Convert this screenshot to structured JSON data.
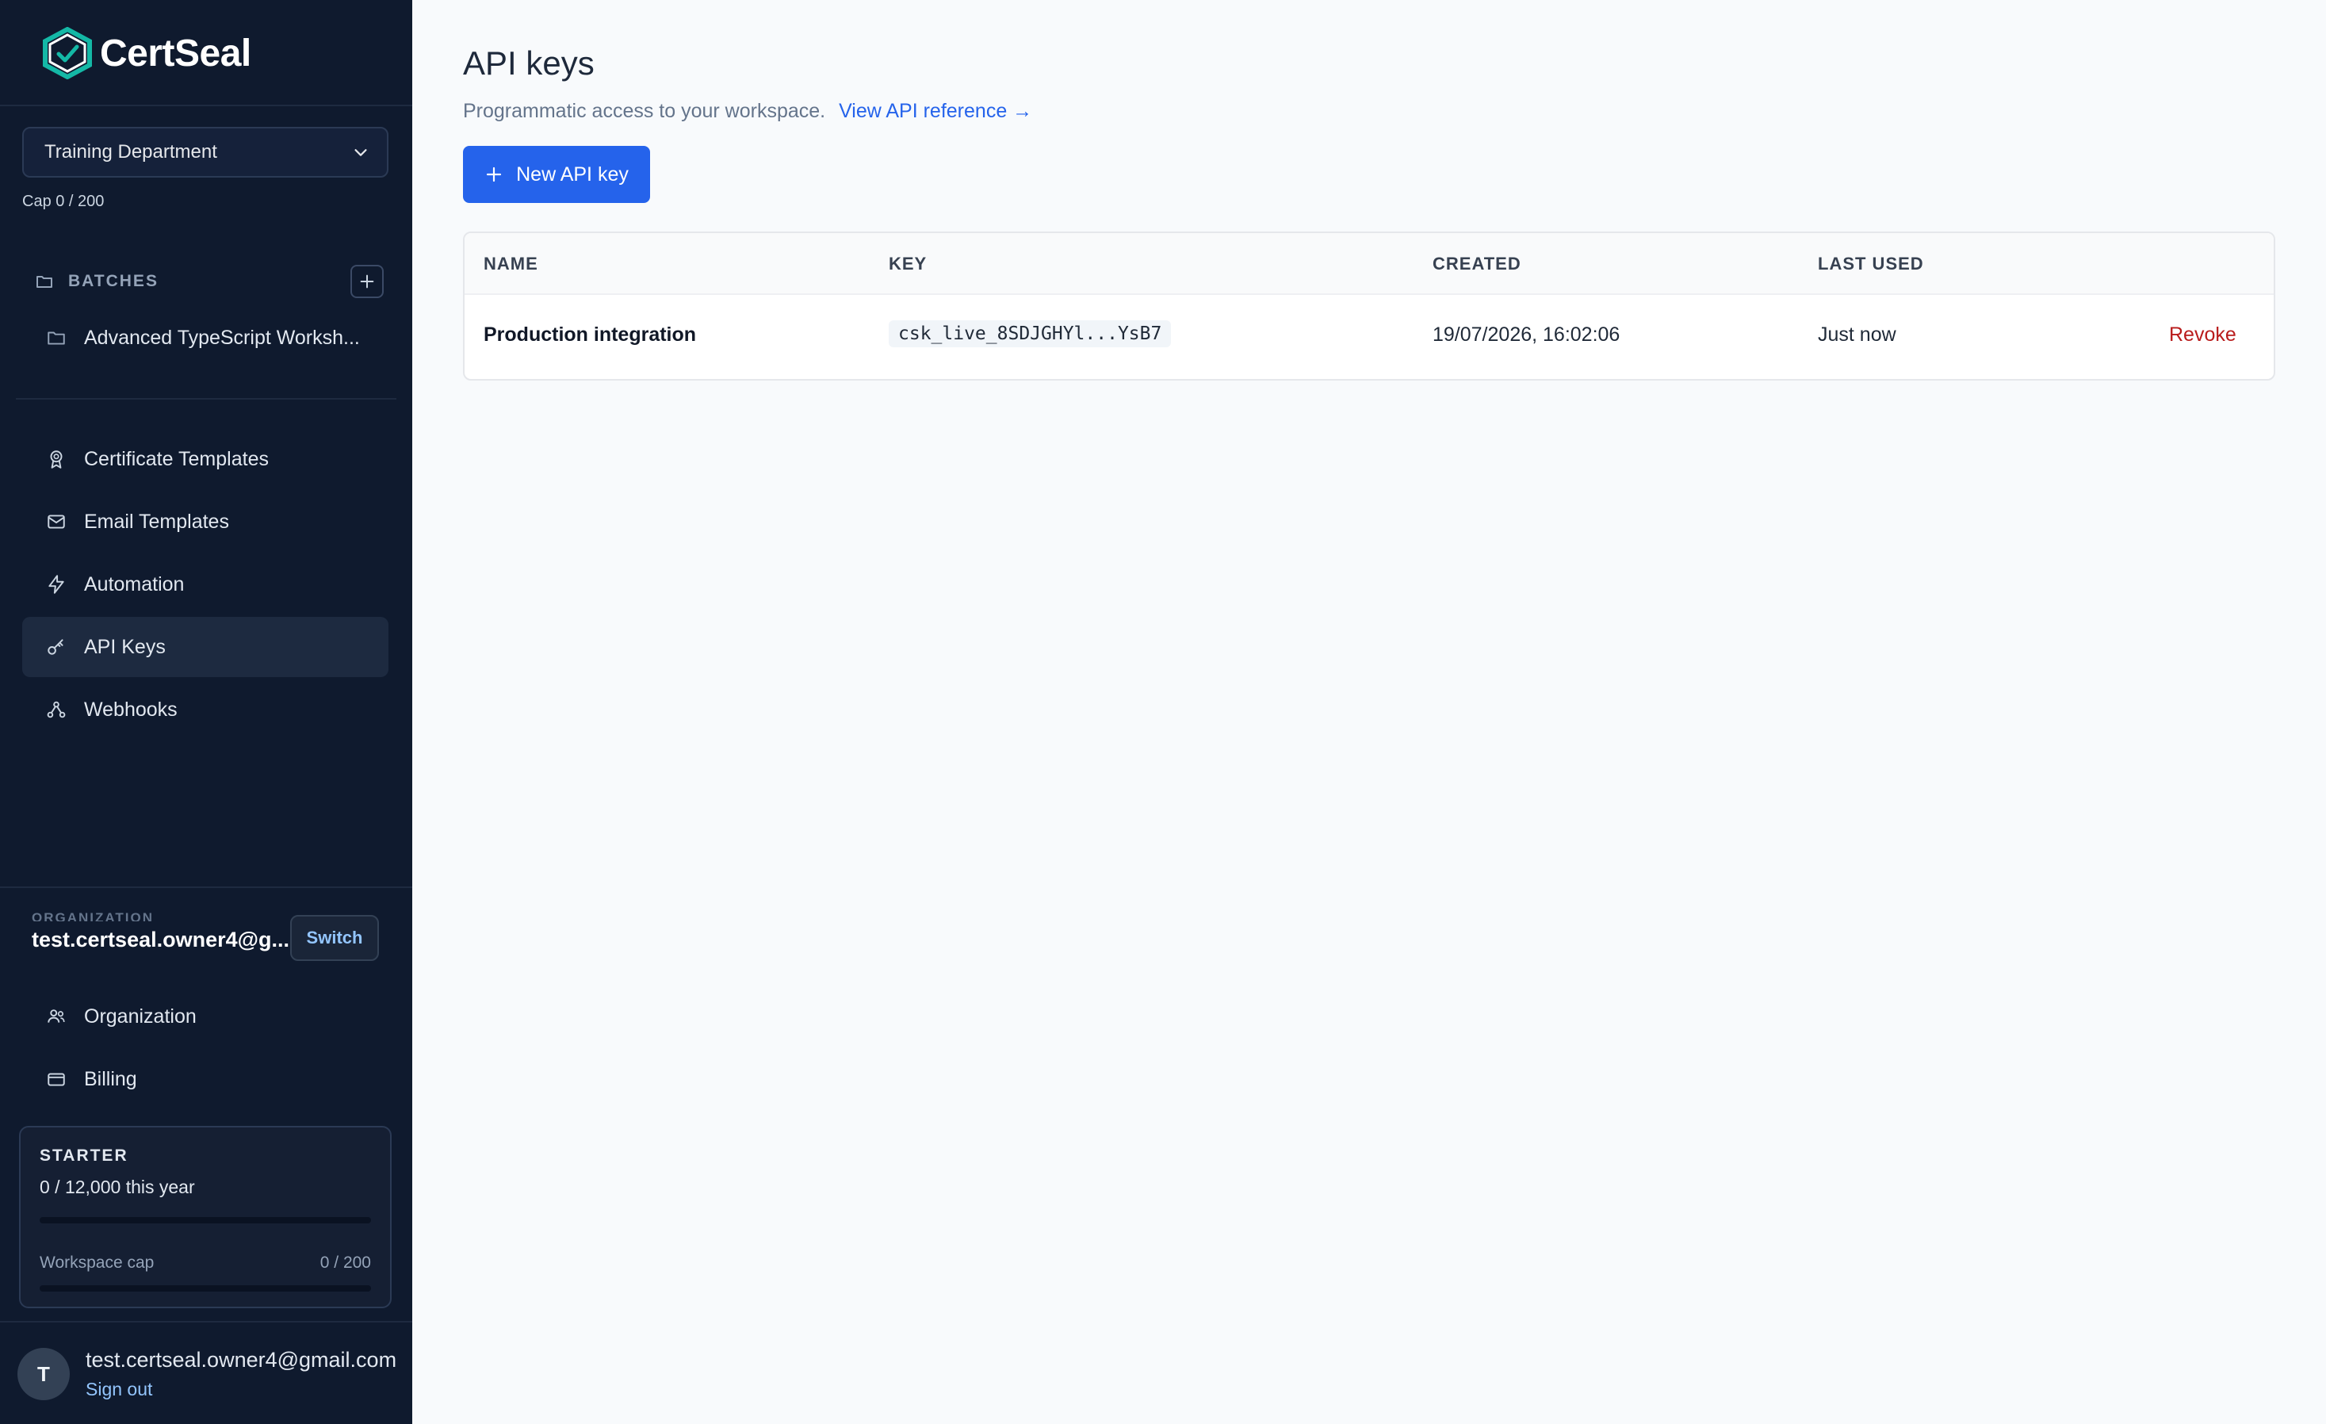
{
  "app": {
    "name": "CertSeal"
  },
  "workspace": {
    "selected": "Training Department",
    "cap_text": "Cap 0 / 200"
  },
  "batches": {
    "title": "BATCHES",
    "items": [
      {
        "label": "Advanced TypeScript Worksh..."
      }
    ]
  },
  "nav": {
    "items": [
      {
        "label": "Certificate Templates",
        "icon": "award-icon"
      },
      {
        "label": "Email Templates",
        "icon": "mail-icon"
      },
      {
        "label": "Automation",
        "icon": "zap-icon"
      },
      {
        "label": "API Keys",
        "icon": "key-icon",
        "active": true
      },
      {
        "label": "Webhooks",
        "icon": "webhook-icon"
      }
    ]
  },
  "organization": {
    "label": "ORGANIZATION",
    "name": "test.certseal.owner4@g...",
    "switch_label": "Switch",
    "items": [
      {
        "label": "Organization",
        "icon": "users-icon"
      },
      {
        "label": "Billing",
        "icon": "credit-card-icon"
      }
    ]
  },
  "plan": {
    "name": "STARTER",
    "usage": "0 / 12,000 this year",
    "usage_fraction": 0,
    "cap_label": "Workspace cap",
    "cap_value": "0 / 200",
    "cap_fraction": 0
  },
  "user": {
    "initial": "T",
    "email": "test.certseal.owner4@gmail.com",
    "signout": "Sign out"
  },
  "page": {
    "title": "API keys",
    "subtitle": "Programmatic access to your workspace.",
    "reference_link": "View API reference →",
    "new_button": "New API key"
  },
  "table": {
    "headers": {
      "name": "NAME",
      "key": "KEY",
      "created": "CREATED",
      "last_used": "LAST USED"
    },
    "rows": [
      {
        "name": "Production integration",
        "key": "csk_live_8SDJGHYl...YsB7",
        "created": "19/07/2026, 16:02:06",
        "last_used": "Just now",
        "action": "Revoke"
      }
    ]
  },
  "colors": {
    "sidebar_bg": "#0f1a2e",
    "accent": "#2563eb",
    "brand_teal": "#14b8a6",
    "danger": "#b91c1c"
  }
}
